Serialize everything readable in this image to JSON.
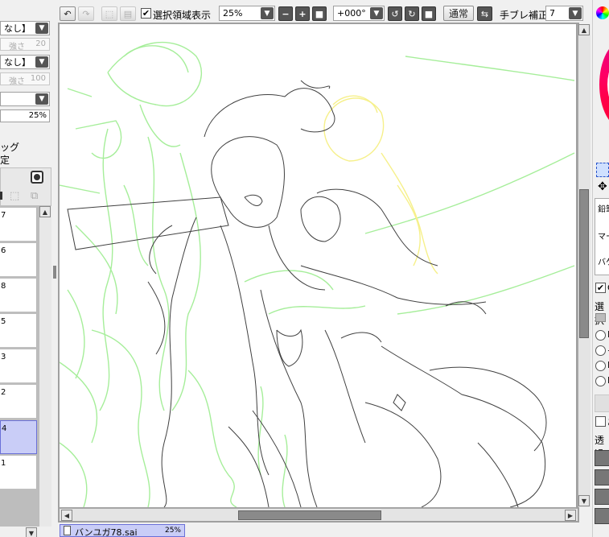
{
  "toolbar": {
    "selection_display_label": "選択領域表示",
    "selection_display_checked": "✔",
    "zoom_value": "25%",
    "rotation_value": "+000°",
    "blend_mode_label": "通常",
    "stabilizer_label": "手ブレ補正",
    "stabilizer_value": "7"
  },
  "left_panel": {
    "combo1_value": "なし】",
    "combo2_value": "なし】",
    "strength1_label": "強さ",
    "strength1_value": "20",
    "strength2_label": "強さ",
    "strength2_value": "100",
    "opacity_value": "25%",
    "clipping_label": "ッグ",
    "lock_label": "定"
  },
  "layers": [
    {
      "name": "7"
    },
    {
      "name": "6"
    },
    {
      "name": "8"
    },
    {
      "name": "5"
    },
    {
      "name": "3"
    },
    {
      "name": "2"
    },
    {
      "name": "4"
    },
    {
      "name": "1"
    }
  ],
  "right_panel": {
    "tool_label_1": "鉛筆",
    "tool_label_2": "マー",
    "tool_label_3": "バケ",
    "check_label": "C",
    "selection_label": "選択",
    "radio_labels": [
      "I",
      "デ",
      "I",
      "D"
    ],
    "antialias_label": "あ",
    "transparent_label": "透過"
  },
  "document_tab": {
    "filename": "バンユガ78.sai",
    "zoom": "25%"
  },
  "colors": {
    "canvas_bg": "#ffffff",
    "sketch_green": "#a6ee9a",
    "sketch_yellow": "#f6f08a",
    "lineart": "#404040",
    "selected_layer": "#c9cdf7"
  }
}
